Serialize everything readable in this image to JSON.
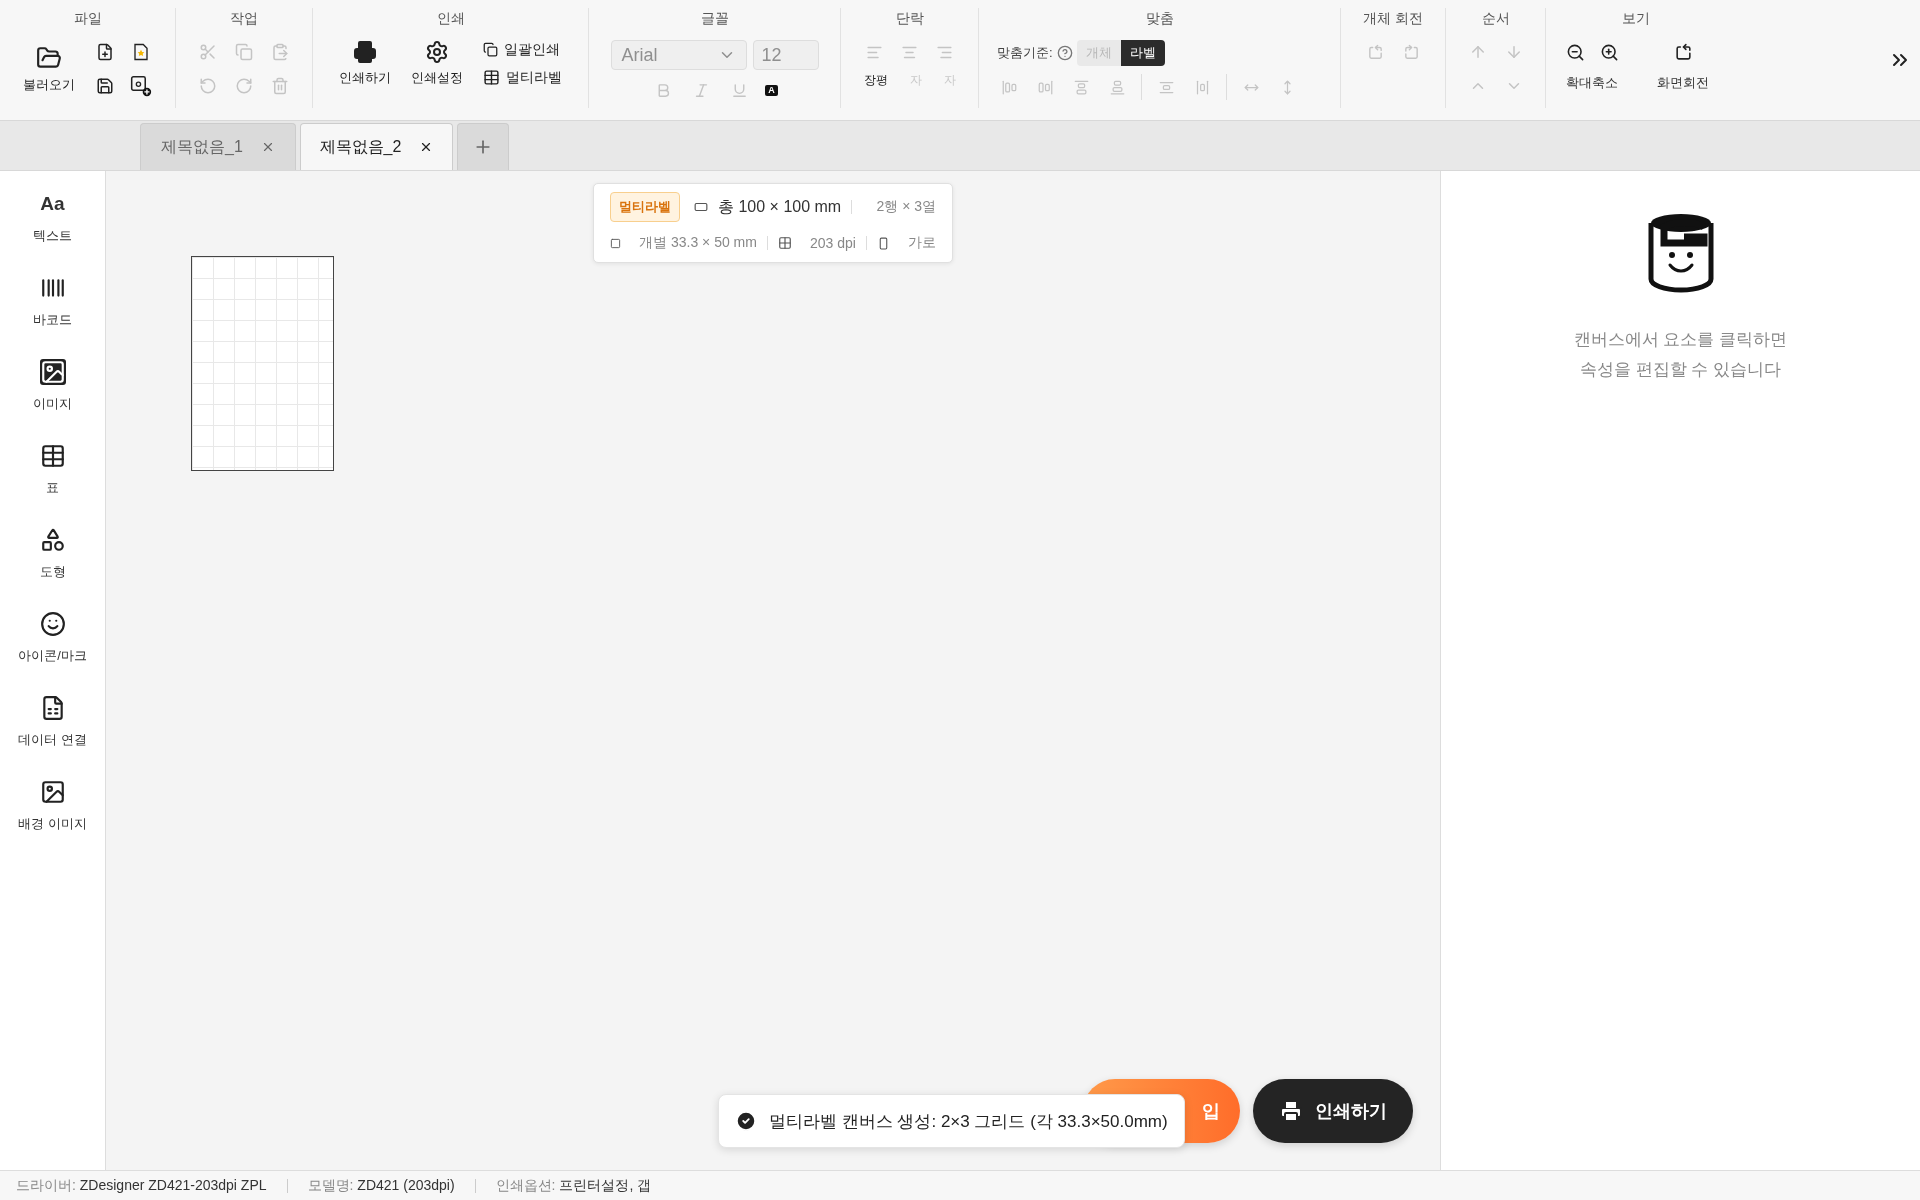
{
  "toolbar": {
    "groups": [
      {
        "kind": "file",
        "title": "파일",
        "buttons": [
          {
            "label": "불러오기",
            "disabled": false
          },
          {
            "disabled": false
          },
          {
            "disabled": false
          },
          {
            "disabled": false
          },
          {
            "disabled": false
          }
        ]
      },
      {
        "kind": "edit",
        "title": "작업",
        "buttons": [
          {
            "disabled": true
          },
          {
            "disabled": true
          },
          {
            "disabled": true
          },
          {
            "disabled": true
          },
          {
            "disabled": true
          },
          {
            "disabled": true
          }
        ]
      },
      {
        "kind": "print",
        "title": "인쇄",
        "buttons": [
          {
            "label": "인쇄하기",
            "disabled": false
          },
          {
            "label": "인쇄설정",
            "disabled": false
          },
          {
            "label": "일괄인쇄",
            "disabled": false
          },
          {
            "label": "멀티라벨",
            "disabled": false
          }
        ]
      },
      {
        "kind": "font",
        "title": "글꼴",
        "family": "Arial",
        "size": "12",
        "disabled": true,
        "buttons": [
          {
            "disabled": true
          },
          {
            "disabled": true
          },
          {
            "disabled": true
          },
          {
            "glyph": "A",
            "disabled": false
          }
        ]
      },
      {
        "kind": "paragraph",
        "title": "단락",
        "buttons": [
          {
            "disabled": true
          },
          {
            "disabled": true
          },
          {
            "disabled": true
          },
          {
            "label": "장평",
            "disabled": false
          },
          {
            "label": "자",
            "disabled": true
          },
          {
            "label": "자",
            "disabled": true
          }
        ]
      },
      {
        "kind": "align",
        "title": "맞춤",
        "basis_label": "맞춤기준:",
        "options": [
          {
            "label": "개체",
            "selected": false
          },
          {
            "label": "라벨",
            "selected": true
          }
        ],
        "buttons": [
          {
            "disabled": true
          },
          {
            "disabled": true
          },
          {
            "disabled": true
          },
          {
            "disabled": true
          },
          {
            "disabled": true
          },
          {
            "disabled": true
          },
          {
            "disabled": true
          },
          {
            "disabled": true
          }
        ]
      },
      {
        "kind": "rotate",
        "title": "개체 회전",
        "buttons": [
          {
            "disabled": true
          },
          {
            "disabled": true
          }
        ]
      },
      {
        "kind": "order",
        "title": "순서",
        "buttons": [
          {
            "disabled": true
          },
          {
            "disabled": true
          },
          {
            "disabled": true
          },
          {
            "disabled": true
          }
        ]
      },
      {
        "kind": "view",
        "title": "보기",
        "items": [
          {
            "label": "확대축소"
          },
          {
            "label": "화면회전"
          }
        ]
      }
    ]
  },
  "tabs": [
    {
      "label": "제목없음_1",
      "selected": false
    },
    {
      "label": "제목없음_2",
      "selected": true
    }
  ],
  "sidebar": {
    "items": [
      {
        "glyph": "Aa",
        "label": "텍스트"
      },
      {
        "label": "바코드"
      },
      {
        "label": "이미지"
      },
      {
        "label": "표"
      },
      {
        "label": "도형"
      },
      {
        "label": "아이콘/마크"
      },
      {
        "label": "데이터 연결"
      },
      {
        "label": "배경 이미지"
      }
    ]
  },
  "info_card": {
    "badge": "멀티라벨",
    "total": "총 100 × 100 mm",
    "grid": "2행 × 3열",
    "single": "개별 33.3 × 50 mm",
    "dpi": "203 dpi",
    "orientation": "가로"
  },
  "toast": "멀티라벨 캔버스 생성: 2×3 그리드 (각 33.3×50.0mm)",
  "floating_buttons": [
    {
      "kind": "orange",
      "label": "입"
    },
    {
      "kind": "print",
      "label": "인쇄하기"
    }
  ],
  "right_panel": {
    "hint": [
      "캔버스에서 요소를 클릭하면",
      "속성을 편집할 수 있습니다"
    ]
  },
  "status_bar": [
    {
      "label": "드라이버:",
      "value": "ZDesigner ZD421-203dpi ZPL"
    },
    {
      "label": "모델명:",
      "value": "ZD421 (203dpi)"
    },
    {
      "label": "인쇄옵션:",
      "value": "프린터설정, 갭"
    }
  ]
}
